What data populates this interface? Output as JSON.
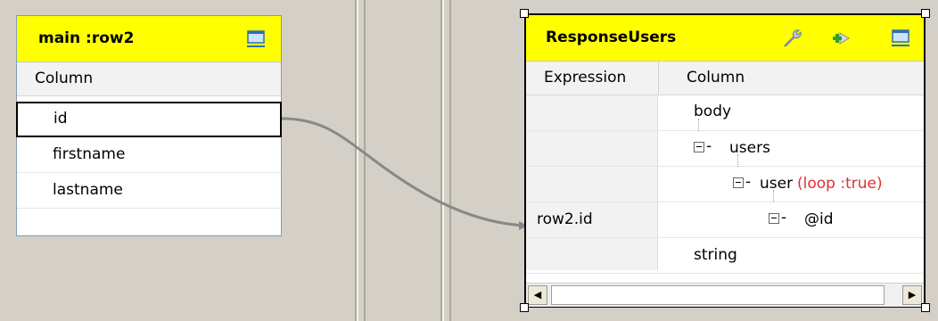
{
  "source_panel": {
    "title": "main :row2",
    "column_header": "Column",
    "rows": [
      "id",
      "firstname",
      "lastname"
    ]
  },
  "target_panel": {
    "title": "ResponseUsers",
    "expression_header": "Expression",
    "column_header": "Column",
    "tree": {
      "body": "body",
      "users": "users",
      "user": "user",
      "user_loop": "(loop :true)",
      "id_attr": "@id",
      "string": "string"
    },
    "expression_value": "row2.id"
  },
  "colors": {
    "header_bg": "#ffff00",
    "loop_text": "#e03030",
    "link_line": "#888888"
  },
  "icons": [
    "panel-minimize-icon",
    "wrench-icon",
    "add-output-icon"
  ]
}
